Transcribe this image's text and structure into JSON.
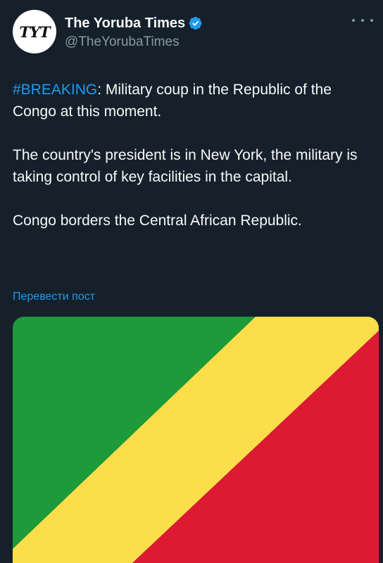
{
  "account": {
    "display_name": "The Yoruba Times",
    "handle": "@TheYorubaTimes",
    "avatar_monogram": "TYT",
    "verified": true
  },
  "tweet": {
    "hashtag": "#BREAKING",
    "line1_rest": ": Military coup in the Republic of the Congo at this moment.",
    "paragraph2": "The country's president is in New York, the military is taking control of key facilities in the capital.",
    "paragraph3": "Congo borders the Central African Republic.",
    "translate_label": "Перевести пост"
  },
  "media": {
    "type": "flag-image",
    "icon_name": "republic-of-congo-flag",
    "colors": {
      "green": "#1d9a3a",
      "yellow": "#fbde4a",
      "red": "#dc1b33"
    }
  },
  "colors": {
    "background": "#15202b",
    "text": "#f7f9f9",
    "secondary": "#8b98a5",
    "accent": "#1d9bf0"
  }
}
